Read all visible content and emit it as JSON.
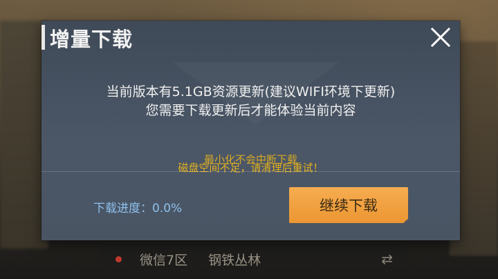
{
  "dialog": {
    "title": "增量下载",
    "message_line1": "当前版本有5.1GB资源更新(建议WIFI环境下更新)",
    "message_line2": "您需要下载更新后才能体验当前内容",
    "hint_background": "最小化不会中断下载",
    "hint_warning": "磁盘空间不足，请清理后重试！",
    "progress_label": "下载进度：0.0%",
    "continue_button": "继续下载",
    "accent_color": "#ec9632",
    "warning_color": "#e6b21e",
    "progress_color": "#8ec1ee"
  },
  "background": {
    "server_label": "微信7区",
    "mode_label": "钢铁丛林"
  },
  "icons": {
    "close": "close-icon",
    "swap": "swap-arrows-icon",
    "server_status": "status-dot-icon"
  }
}
